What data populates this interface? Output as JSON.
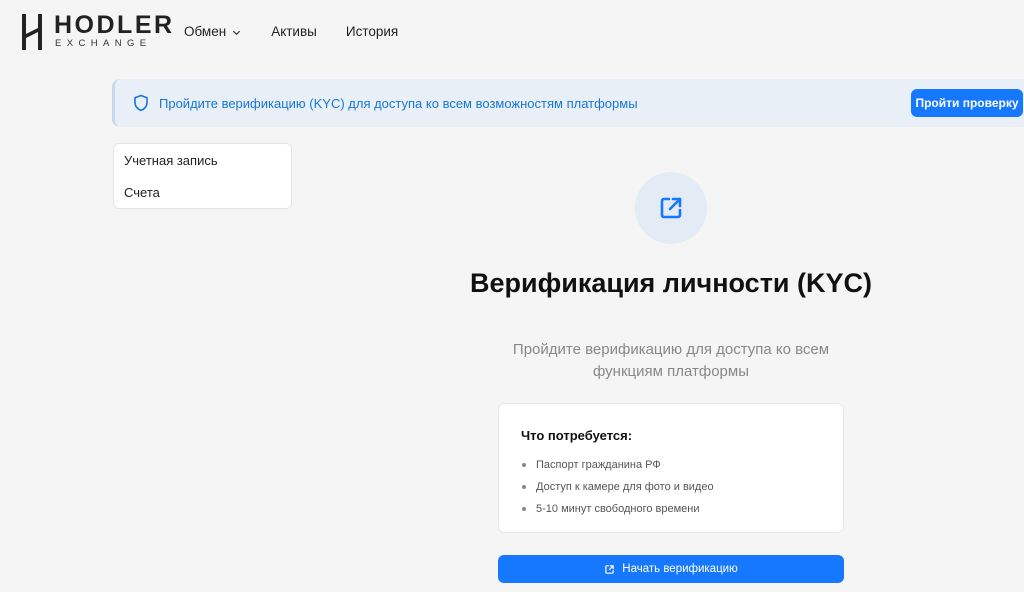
{
  "brand": {
    "name": "HODLER",
    "sub": "EXCHANGE"
  },
  "nav": {
    "items": [
      {
        "label": "Обмен",
        "has_dropdown": true,
        "icon": "chevron-down-icon"
      },
      {
        "label": "Активы"
      },
      {
        "label": "История"
      }
    ]
  },
  "banner": {
    "icon": "shield-icon",
    "text": "Пройдите верификацию (KYC) для доступа ко всем возможностям платформы",
    "button_label": "Пройти проверку"
  },
  "sidebar": {
    "items": [
      {
        "label": "Учетная запись"
      },
      {
        "label": "Счета"
      }
    ]
  },
  "kyc": {
    "icon": "external-link-icon",
    "title": "Верификация личности (KYC)",
    "subtitle": "Пройдите верификацию для доступа ко всем функциям платформы",
    "requirements_title": "Что потребуется:",
    "requirements": [
      "Паспорт гражданина РФ",
      "Доступ к камере для фото и видео",
      "5-10 минут свободного времени"
    ],
    "start_button_label": "Начать верификацию"
  },
  "colors": {
    "accent": "#1677ff",
    "banner_bg": "#e9eff6",
    "banner_text": "#1777d9",
    "icon_circle_bg": "#e3ebf4"
  }
}
